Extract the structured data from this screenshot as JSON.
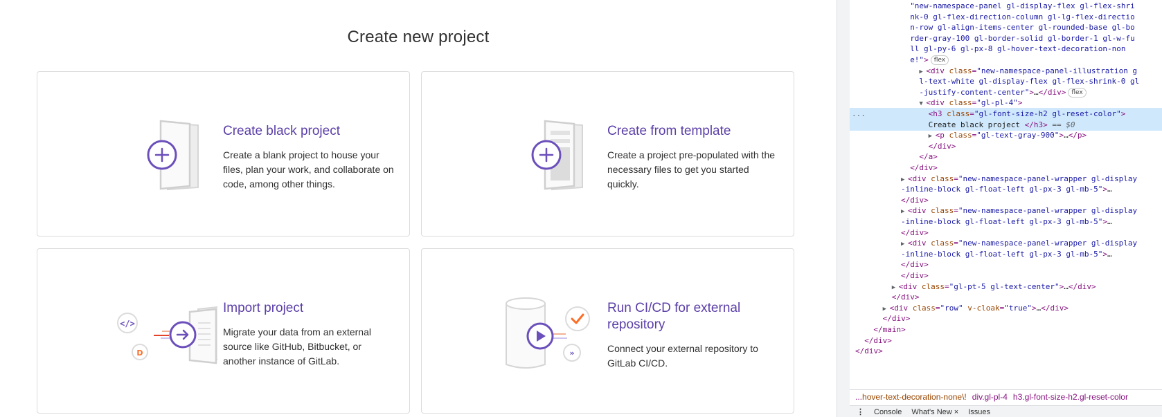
{
  "page": {
    "title": "Create new project"
  },
  "panels": [
    {
      "title": "Create black project",
      "description": "Create a blank project to house your files, plan your work, and collaborate on code, among other things.",
      "illustration": "blank-project-plus-icon"
    },
    {
      "title": "Create from template",
      "description": "Create a project pre-populated with the necessary files to get you started quickly.",
      "illustration": "template-plus-icon"
    },
    {
      "title": "Import project",
      "description": "Migrate your data from an external source like GitHub, Bitbucket, or another instance of GitLab.",
      "illustration": "import-arrow-icon"
    },
    {
      "title": "Run CI/CD for external repository",
      "description": "Connect your external repository to GitLab CI/CD.",
      "illustration": "cicd-play-icon"
    }
  ],
  "devtools": {
    "lines": [
      {
        "indent": 12,
        "html": "<span class='val'>\"new-namespace-panel gl-display-flex gl-flex-shri</span>"
      },
      {
        "indent": 12,
        "html": "<span class='val'>nk-0 gl-flex-direction-column gl-lg-flex-directio</span>"
      },
      {
        "indent": 12,
        "html": "<span class='val'>n-row gl-align-items-center gl-rounded-base gl-bo</span>"
      },
      {
        "indent": 12,
        "html": "<span class='val'>rder-gray-100 gl-border-solid gl-border-1 gl-w-fu</span>"
      },
      {
        "indent": 12,
        "html": "<span class='val'>ll gl-py-6 gl-px-8 gl-hover-text-decoration-non</span>"
      },
      {
        "indent": 12,
        "html": "<span class='val'>e!\"</span><span class='tag'>&gt;</span><span class='pill'>flex</span>"
      },
      {
        "indent": 14,
        "html": "<span class='tri'>▶</span><span class='tag'>&lt;div </span><span class='attr'>class</span><span class='tag'>=</span><span class='val'>\"new-namespace-panel-illustration g</span>"
      },
      {
        "indent": 14,
        "html": "<span class='val'>l-text-white gl-display-flex gl-flex-shrink-0 gl</span>"
      },
      {
        "indent": 14,
        "html": "<span class='val'>-justify-content-center\"</span><span class='tag'>&gt;</span>…<span class='tag'>&lt;/div&gt;</span><span class='pill'>flex</span>"
      },
      {
        "indent": 14,
        "html": "<span class='tri'>▼</span><span class='tag'>&lt;div </span><span class='attr'>class</span><span class='tag'>=</span><span class='val'>\"gl-pl-4\"</span><span class='tag'>&gt;</span>"
      },
      {
        "indent": 16,
        "hl": true,
        "html": "<span class='tag'>&lt;h3 </span><span class='attr'>class</span><span class='tag'>=</span><span class='val'>\"gl-font-size-h2 gl-reset-color\"</span><span class='tag'>&gt;</span>"
      },
      {
        "indent": 16,
        "hl": true,
        "html": "<span class='txt'>Create black project </span><span class='tag'>&lt;/h3&gt;</span><span class='eq'> == $0</span>"
      },
      {
        "indent": 16,
        "html": "<span class='tri'>▶</span><span class='tag'>&lt;p </span><span class='attr'>class</span><span class='tag'>=</span><span class='val'>\"gl-text-gray-900\"</span><span class='tag'>&gt;</span>…<span class='tag'>&lt;/p&gt;</span>"
      },
      {
        "indent": 16,
        "html": "<span class='tag'>&lt;/div&gt;</span>"
      },
      {
        "indent": 14,
        "html": "<span class='tag'>&lt;/a&gt;</span>"
      },
      {
        "indent": 12,
        "html": "<span class='tag'>&lt;/div&gt;</span>"
      },
      {
        "indent": 10,
        "html": "<span class='tri'>▶</span><span class='tag'>&lt;div </span><span class='attr'>class</span><span class='tag'>=</span><span class='val'>\"new-namespace-panel-wrapper gl-display</span>"
      },
      {
        "indent": 10,
        "html": "<span class='val'>-inline-block gl-float-left gl-px-3 gl-mb-5\"</span><span class='tag'>&gt;</span>…"
      },
      {
        "indent": 10,
        "html": "<span class='tag'>&lt;/div&gt;</span>"
      },
      {
        "indent": 10,
        "html": "<span class='tri'>▶</span><span class='tag'>&lt;div </span><span class='attr'>class</span><span class='tag'>=</span><span class='val'>\"new-namespace-panel-wrapper gl-display</span>"
      },
      {
        "indent": 10,
        "html": "<span class='val'>-inline-block gl-float-left gl-px-3 gl-mb-5\"</span><span class='tag'>&gt;</span>…"
      },
      {
        "indent": 10,
        "html": "<span class='tag'>&lt;/div&gt;</span>"
      },
      {
        "indent": 10,
        "html": "<span class='tri'>▶</span><span class='tag'>&lt;div </span><span class='attr'>class</span><span class='tag'>=</span><span class='val'>\"new-namespace-panel-wrapper gl-display</span>"
      },
      {
        "indent": 10,
        "html": "<span class='val'>-inline-block gl-float-left gl-px-3 gl-mb-5\"</span><span class='tag'>&gt;</span>…"
      },
      {
        "indent": 10,
        "html": "<span class='tag'>&lt;/div&gt;</span>"
      },
      {
        "indent": 10,
        "html": "<span class='tag'>&lt;/div&gt;</span>"
      },
      {
        "indent": 8,
        "html": "<span class='tri'>▶</span><span class='tag'>&lt;div </span><span class='attr'>class</span><span class='tag'>=</span><span class='val'>\"gl-pt-5 gl-text-center\"</span><span class='tag'>&gt;</span>…<span class='tag'>&lt;/div&gt;</span>"
      },
      {
        "indent": 8,
        "html": "<span class='tag'>&lt;/div&gt;</span>"
      },
      {
        "indent": 6,
        "html": "<span class='tri'>▶</span><span class='tag'>&lt;div </span><span class='attr'>class</span><span class='tag'>=</span><span class='val'>\"row\"</span><span class='attr'> v-cloak</span><span class='tag'>=</span><span class='val'>\"true\"</span><span class='tag'>&gt;</span>…<span class='tag'>&lt;/div&gt;</span>"
      },
      {
        "indent": 6,
        "html": "<span class='tag'>&lt;/div&gt;</span>"
      },
      {
        "indent": 4,
        "html": "<span class='tag'>&lt;/main&gt;</span>"
      },
      {
        "indent": 2,
        "html": "<span class='tag'>&lt;/div&gt;</span>"
      },
      {
        "indent": 0,
        "html": "<span class='tag'>&lt;/div&gt;</span>"
      }
    ],
    "highlight_ellipsis": "...",
    "breadcrumbs": {
      "ellipsis": "...",
      "items": [
        "hover-text-decoration-none\\!",
        "div.gl-pl-4",
        "h3.gl-font-size-h2.gl-reset-color"
      ]
    },
    "drawer": {
      "menu": "⋮",
      "tabs": [
        "Console",
        "What's New ×",
        "Issues"
      ]
    }
  }
}
